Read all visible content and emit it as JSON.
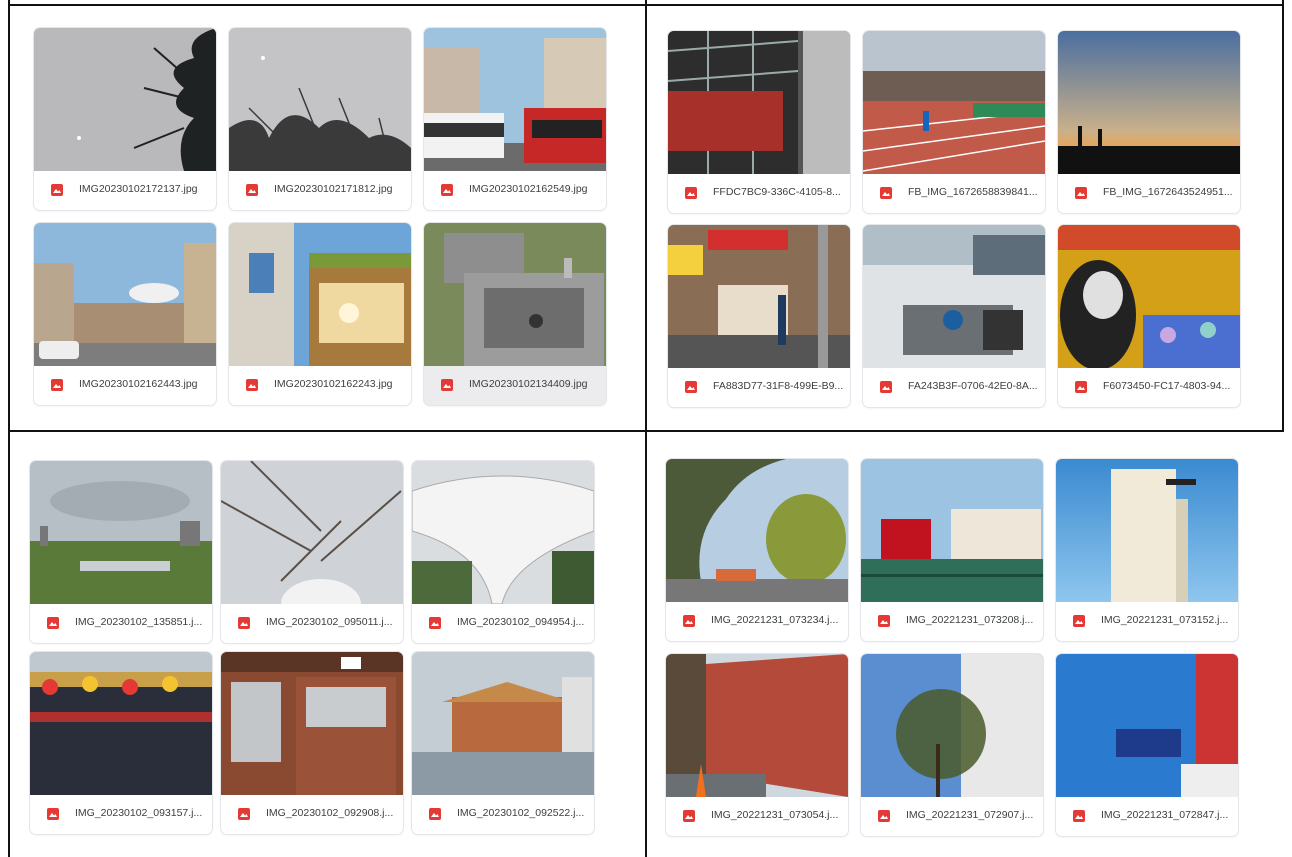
{
  "panels": [
    {
      "files": [
        {
          "name": "IMG20230102172137.jpg",
          "scene": "sky-tree",
          "icon": "image-file-icon"
        },
        {
          "name": "IMG20230102171812.jpg",
          "scene": "sky-branches",
          "icon": "image-file-icon"
        },
        {
          "name": "IMG20230102162549.jpg",
          "scene": "street-bus",
          "icon": "image-file-icon"
        },
        {
          "name": "IMG20230102162443.jpg",
          "scene": "street-sky",
          "icon": "image-file-icon"
        },
        {
          "name": "IMG20230102162243.jpg",
          "scene": "building-glass",
          "icon": "image-file-icon"
        },
        {
          "name": "IMG20230102134409.jpg",
          "scene": "stone-box",
          "icon": "image-file-icon",
          "selected": true
        }
      ]
    },
    {
      "files": [
        {
          "name": "FFDC7BC9-336C-4105-8...",
          "scene": "sign-building",
          "icon": "image-file-icon"
        },
        {
          "name": "FB_IMG_1672658839841...",
          "scene": "track",
          "icon": "image-file-icon"
        },
        {
          "name": "FB_IMG_1672643524951...",
          "scene": "sunset",
          "icon": "image-file-icon"
        },
        {
          "name": "FA883D77-31F8-499E-B9...",
          "scene": "street-shops",
          "icon": "image-file-icon"
        },
        {
          "name": "FA243B3F-0706-42E0-8A...",
          "scene": "river-pump",
          "icon": "image-file-icon"
        },
        {
          "name": "F6073450-FC17-4803-94...",
          "scene": "claw-machine",
          "icon": "image-file-icon"
        }
      ]
    },
    {
      "files": [
        {
          "name": "IMG_20230102_135851.j...",
          "scene": "wetland",
          "icon": "image-file-icon"
        },
        {
          "name": "IMG_20230102_095011.j...",
          "scene": "branches-dome",
          "icon": "image-file-icon"
        },
        {
          "name": "IMG_20230102_094954.j...",
          "scene": "canopy",
          "icon": "image-file-icon"
        },
        {
          "name": "IMG_20230102_093157.j...",
          "scene": "temple-lanterns",
          "icon": "image-file-icon"
        },
        {
          "name": "IMG_20230102_092908.j...",
          "scene": "wooden-door",
          "icon": "image-file-icon"
        },
        {
          "name": "IMG_20230102_092522.j...",
          "scene": "temple-river",
          "icon": "image-file-icon"
        }
      ]
    },
    {
      "files": [
        {
          "name": "IMG_20221231_073234.j...",
          "scene": "tree-street",
          "icon": "image-file-icon"
        },
        {
          "name": "IMG_20221231_073208.j...",
          "scene": "houses-fence",
          "icon": "image-file-icon"
        },
        {
          "name": "IMG_20221231_073152.j...",
          "scene": "tower-building",
          "icon": "image-file-icon"
        },
        {
          "name": "IMG_20221231_073054.j...",
          "scene": "brick-wall",
          "icon": "image-file-icon"
        },
        {
          "name": "IMG_20221231_072907.j...",
          "scene": "tree-wall",
          "icon": "image-file-icon"
        },
        {
          "name": "IMG_20221231_072847.j...",
          "scene": "blue-sign",
          "icon": "image-file-icon"
        }
      ]
    }
  ],
  "colors": {
    "file_icon": "#e53935",
    "caption_text": "#3c4043",
    "grid_line": "#111111"
  }
}
